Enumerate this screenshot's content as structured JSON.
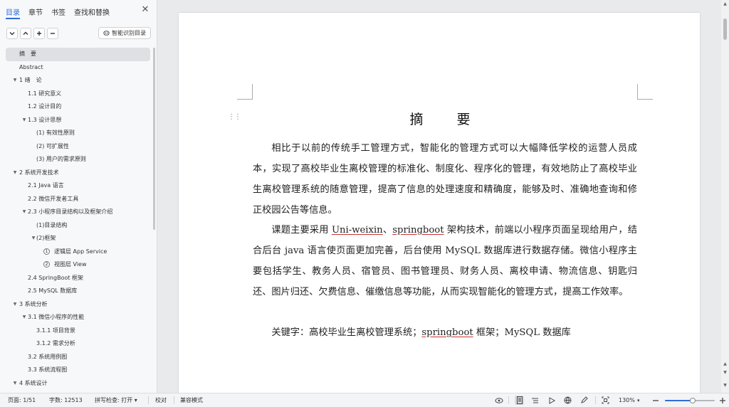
{
  "sidebar": {
    "tabs": [
      {
        "label": "目录",
        "active": true
      },
      {
        "label": "章节",
        "active": false
      },
      {
        "label": "书签",
        "active": false
      },
      {
        "label": "查找和替换",
        "active": false
      }
    ],
    "smart_toc_label": "智能识别目录",
    "toc": [
      {
        "label": "摘　要",
        "level": 0,
        "caret": false,
        "selected": true
      },
      {
        "label": "Abstract",
        "level": 0,
        "caret": false
      },
      {
        "label": "1 绪　论",
        "level": 0,
        "caret": true
      },
      {
        "label": "1.1 研究意义",
        "level": 1,
        "caret": false
      },
      {
        "label": "1.2 设计目的",
        "level": 1,
        "caret": false
      },
      {
        "label": "1.3 设计思想",
        "level": 1,
        "caret": true
      },
      {
        "label": "(1) 有效性原则",
        "level": 2,
        "caret": false
      },
      {
        "label": "(2) 可扩展性",
        "level": 2,
        "caret": false
      },
      {
        "label": "(3) 用户的需求原则",
        "level": 2,
        "caret": false
      },
      {
        "label": "2 系统开发技术",
        "level": 0,
        "caret": true
      },
      {
        "label": "2.1 Java 语言",
        "level": 1,
        "caret": false
      },
      {
        "label": "2.2 微信开发者工具",
        "level": 1,
        "caret": false
      },
      {
        "label": "2.3 小程序目录结构以及框架介绍",
        "level": 1,
        "caret": true
      },
      {
        "label": "(1)目录结构",
        "level": 2,
        "caret": false
      },
      {
        "label": "(2)框架",
        "level": 2,
        "caret": true
      },
      {
        "label": "逻辑层 App Service",
        "level": 3,
        "caret": false,
        "num": "1"
      },
      {
        "label": "视图层 View",
        "level": 3,
        "caret": false,
        "num": "2"
      },
      {
        "label": "2.4 SpringBoot 框架",
        "level": 1,
        "caret": false
      },
      {
        "label": "2.5 MySQL 数据库",
        "level": 1,
        "caret": false
      },
      {
        "label": "3 系统分析",
        "level": 0,
        "caret": true
      },
      {
        "label": "3.1 微信小程序的性能",
        "level": 1,
        "caret": true
      },
      {
        "label": "3.1.1 项目背景",
        "level": 2,
        "caret": false
      },
      {
        "label": "3.1.2 需求分析",
        "level": 2,
        "caret": false
      },
      {
        "label": "3.2 系统用例图",
        "level": 1,
        "caret": false
      },
      {
        "label": "3.3 系统流程图",
        "level": 1,
        "caret": false
      },
      {
        "label": "4 系统设计",
        "level": 0,
        "caret": true
      }
    ]
  },
  "document": {
    "title": "摘　要",
    "para1": "相比于以前的传统手工管理方式，智能化的管理方式可以大幅降低学校的运营人员成本，实现了高校毕业生离校管理的标准化、制度化、程序化的管理，有效地防止了高校毕业生离校管理系统的随意管理，提高了信息的处理速度和精确度，能够及时、准确地查询和修正校园公告等信息。",
    "para2_a": "课题主要采用 ",
    "para2_u1": "Uni-weixin",
    "para2_b": "、",
    "para2_u2": "springboot",
    "para2_c": " 架构技术，前端以小程序页面呈现给用户，结合后台 java 语言使页面更加完善，后台使用 MySQL 数据库进行数据存储。微信小程序主要包括学生、教务人员、宿管员、图书管理员、财务人员、离校申请、物流信息、钥匙归还、图片归还、欠费信息、催缴信息等功能，从而实现智能化的管理方式，提高工作效率。",
    "kw_label": "关键字：",
    "kw_a": "高校毕业生离校管理系统；",
    "kw_u": "springboot",
    "kw_b": " 框架；MySQL 数据库"
  },
  "status": {
    "page": "页面: 1/51",
    "words": "字数: 12513",
    "spellcheck": "拼写检查: 打开",
    "proofread": "校对",
    "compat": "兼容模式",
    "zoom": "130%",
    "zoom_level": 0.55
  },
  "colors": {
    "accent": "#2f6fd8"
  }
}
